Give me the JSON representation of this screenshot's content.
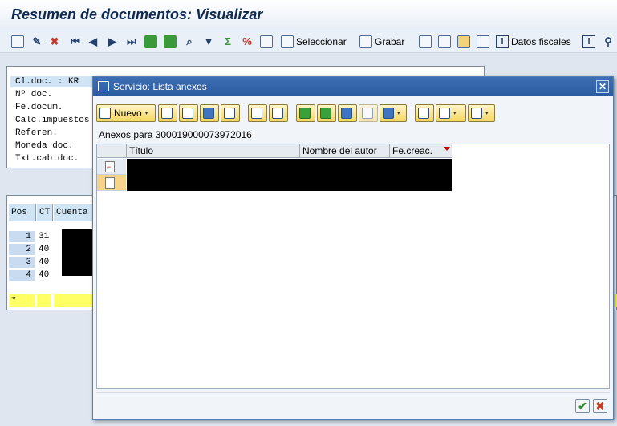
{
  "window": {
    "title": "Resumen de documentos: Visualizar"
  },
  "app_toolbar": {
    "buttons": [
      {
        "icon": "display-icon"
      },
      {
        "icon": "pencil-icon"
      },
      {
        "icon": "delete-icon"
      },
      {
        "icon": "first-page-icon"
      },
      {
        "icon": "previous-page-icon"
      },
      {
        "icon": "next-page-icon"
      },
      {
        "icon": "last-page-icon"
      },
      {
        "icon": "sort-ascending-icon"
      },
      {
        "icon": "sort-descending-icon"
      },
      {
        "icon": "find-icon"
      },
      {
        "icon": "filter-icon"
      },
      {
        "icon": "sum-icon"
      },
      {
        "icon": "subtotal-icon"
      },
      {
        "icon": "choose-layout-icon"
      }
    ],
    "select_label": "Seleccionar",
    "save_label": "Grabar",
    "fiscal_label": "Datos fiscales"
  },
  "header_panel": {
    "rows": [
      "Cl.doc. : KR",
      "Nº doc.",
      "Fe.docum.",
      "Calc.impuestos",
      "Referen.",
      "Moneda doc.",
      "Txt.cab.doc."
    ]
  },
  "items": {
    "columns": [
      "Pos",
      "CT",
      "Cuenta"
    ],
    "rows": [
      {
        "pos": "1",
        "ct": "31"
      },
      {
        "pos": "2",
        "ct": "40"
      },
      {
        "pos": "3",
        "ct": "40"
      },
      {
        "pos": "4",
        "ct": "40"
      }
    ],
    "total_marker": "*"
  },
  "dialog": {
    "title": "Servicio: Lista anexos",
    "new_button": "Nuevo",
    "subtitle": "Anexos para 300019000073972016",
    "columns": {
      "title": "Título",
      "author": "Nombre del autor",
      "created": "Fe.creac."
    },
    "rows": [
      {
        "type": "pdf-document-icon",
        "selected": false
      },
      {
        "type": "attachment-list-icon",
        "selected": true
      }
    ]
  },
  "colors": {
    "dialog_title_bg": "#2a5aa0",
    "row_highlight": "#ffff66",
    "selected_row": "#f8d38a",
    "sort_marker": "#cc0000"
  }
}
